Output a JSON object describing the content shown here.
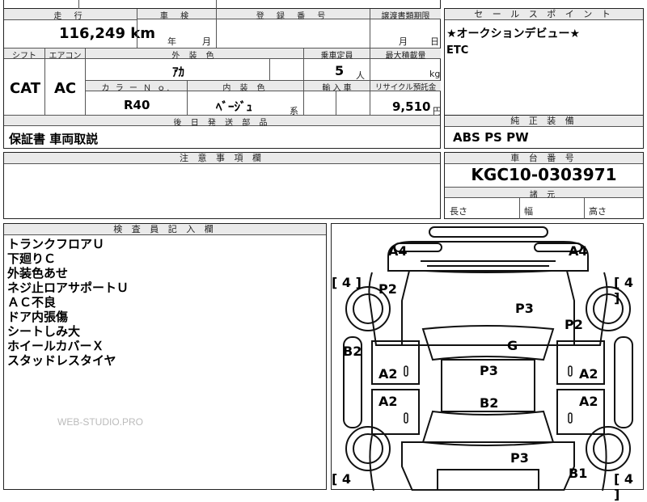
{
  "top_form": {
    "mileage_header": "走 行",
    "inspection_header": "車 検",
    "registration_header": "登 録 番 号",
    "transfer_doc_header": "譲渡書類期限",
    "mileage_value": "116,249 km",
    "inspection_year_unit": "年",
    "inspection_month_unit": "月",
    "transfer_month_unit": "月",
    "transfer_day_unit": "日",
    "shift_header": "シフト",
    "aircon_header": "エアコン",
    "exterior_color_header": "外 装 色",
    "capacity_header": "乗車定員",
    "max_load_header": "最大積載量",
    "shift_value": "CAT",
    "aircon_value": "AC",
    "exterior_color_value": "ｱｶ",
    "capacity_value": "5",
    "capacity_unit": "人",
    "max_load_unit": "kg",
    "color_no_header": "カ ラ ー Ｎ ｏ.",
    "interior_color_header": "内 装 色",
    "import_header": "輸 入 車",
    "recycle_header": "リサイクル預託金",
    "color_no_value": "R40",
    "interior_color_value": "ﾍﾞｰｼﾞｭ",
    "interior_color_suffix": "系",
    "recycle_value": "9,510",
    "recycle_unit": "円",
    "later_parts_header": "後 日 発 送 部 品",
    "later_parts_value": "保証書 車両取説"
  },
  "sales_point": {
    "header": "セ ー ル ス ポ イ ン ト",
    "line1": "★オークションデビュー★",
    "line2": "ETC"
  },
  "genuine_equipment": {
    "header": "純 正 装 備",
    "value": "ABS PS PW"
  },
  "notes": {
    "header": "注 意 事 項 欄"
  },
  "chassis": {
    "header": "車 台 番 号",
    "value": "KGC10-0303971",
    "dimensions_header": "諸 元",
    "length_label": "長さ",
    "width_label": "幅",
    "height_label": "高さ"
  },
  "inspector": {
    "header": "検 査 員 記 入 欄",
    "lines": [
      "トランクフロアＵ",
      "下廻りＣ",
      "外装色あせ",
      "ネジ止ロアサポートＵ",
      "ＡＣ不良",
      "ドア内張傷",
      "シートしみ大",
      "ホイールカバーＸ",
      "スタッドレスタイヤ"
    ],
    "watermark": "WEB-STUDIO.PRO"
  },
  "diagram": {
    "marks": {
      "a4_left": "A4",
      "a4_right": "A4",
      "p2_left": "P2",
      "p3_hood": "P3",
      "p2_right": "P2",
      "b2_left": "B2",
      "g": "G",
      "a2_lf": "A2",
      "p3_roof": "P3",
      "a2_rf": "A2",
      "a2_lr": "A2",
      "b2_center": "B2",
      "a2_rr": "A2",
      "p3_trunk": "P3",
      "b1": "B1"
    },
    "tires": {
      "fl": "[ 4 ]",
      "fr": "[ 4 ]",
      "rl": "[ 4",
      "rr": "[ 4 ]"
    }
  }
}
